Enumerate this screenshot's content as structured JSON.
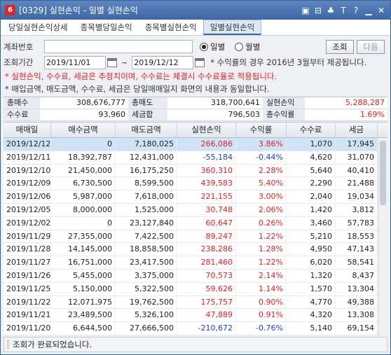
{
  "window": {
    "badge": "6",
    "title": "[0329] 실현손익 - 일별 실현손익",
    "buttons": [
      "▣",
      "⊟",
      "♣",
      "T",
      "?",
      "▁",
      "✕"
    ]
  },
  "tabs": [
    {
      "label": "당일실현손익상세",
      "active": false
    },
    {
      "label": "종목별당일손익",
      "active": false
    },
    {
      "label": "종목별실현손익",
      "active": false
    },
    {
      "label": "일별실현손익",
      "active": true
    }
  ],
  "account": {
    "label": "계좌번호",
    "value": ""
  },
  "period_toggle": {
    "daily": "일별",
    "monthly": "월별"
  },
  "actions": {
    "query": "조회",
    "next": "다음"
  },
  "range": {
    "label": "조회기간",
    "from": "2019/11/01",
    "to": "2019/12/12",
    "sep": "~"
  },
  "notes": {
    "n1": "* 수익률의 경우 2016년 3월부터 제공됩니다.",
    "n2": "* 실현손익, 수수료, 세금은 추정치이며, 수수료는 체결시 수수료율로 적용됩니다.",
    "n3": "* 매입금액, 매도금액, 수수료, 세금은 당일매매일지 화면의 내용과 동일합니다."
  },
  "summary": {
    "buy_label": "총매수",
    "buy": "308,676,777",
    "sell_label": "총매도",
    "sell": "318,700,641",
    "pnl_label": "실현손익",
    "pnl": "5,288,287",
    "fee_label": "수수료",
    "fee": "93,960",
    "tax_label": "세금합",
    "tax": "796,503",
    "ret_label": "총수익률",
    "ret": "1.69%"
  },
  "grid": {
    "headers": [
      "매매일",
      "매수금액",
      "매도금액",
      "실현손익",
      "수익률",
      "수수료",
      "세금"
    ],
    "rows": [
      [
        "2019/12/12",
        "0",
        "7,180,025",
        "266,086",
        "3.86%",
        "1,070",
        "17,945"
      ],
      [
        "2019/12/11",
        "18,392,787",
        "12,431,000",
        "-55,184",
        "-0.44%",
        "4,620",
        "31,070"
      ],
      [
        "2019/12/10",
        "21,450,000",
        "16,175,250",
        "360,310",
        "2.28%",
        "5,640",
        "40,410"
      ],
      [
        "2019/12/09",
        "6,730,500",
        "8,599,500",
        "439,583",
        "5.40%",
        "2,290",
        "21,488"
      ],
      [
        "2019/12/06",
        "5,987,000",
        "7,618,000",
        "221,155",
        "3.00%",
        "2,040",
        "19,034"
      ],
      [
        "2019/12/05",
        "8,000,000",
        "1,525,000",
        "30,748",
        "2.06%",
        "1,420",
        "3,812"
      ],
      [
        "2019/12/02",
        "0",
        "23,127,840",
        "60,647",
        "0.26%",
        "3,460",
        "57,783"
      ],
      [
        "2019/11/29",
        "27,355,000",
        "7,422,500",
        "89,247",
        "1.22%",
        "5,210",
        "18,553"
      ],
      [
        "2019/11/28",
        "14,145,000",
        "18,858,500",
        "238,286",
        "1.28%",
        "4,950",
        "47,143"
      ],
      [
        "2019/11/27",
        "16,751,000",
        "23,417,500",
        "281,460",
        "1.22%",
        "6,020",
        "58,541"
      ],
      [
        "2019/11/26",
        "5,455,000",
        "3,375,000",
        "70,573",
        "2.14%",
        "1,320",
        "8,437"
      ],
      [
        "2019/11/25",
        "5,150,000",
        "5,322,500",
        "59,626",
        "1.14%",
        "1,570",
        "13,304"
      ],
      [
        "2019/11/22",
        "12,071,975",
        "19,762,500",
        "175,757",
        "0.90%",
        "4,770",
        "49,388"
      ],
      [
        "2019/11/21",
        "23,489,500",
        "5,326,100",
        "47,889",
        "0.91%",
        "4,320",
        "13,308"
      ],
      [
        "2019/11/20",
        "6,644,500",
        "27,666,500",
        "-210,672",
        "-0.76%",
        "5,140",
        "69,154"
      ]
    ]
  },
  "status": "조회가 완료되었습니다.",
  "colors": {
    "positive": "#e02020",
    "negative": "#1a3fd1",
    "selected_row": "#cfe3f6"
  }
}
